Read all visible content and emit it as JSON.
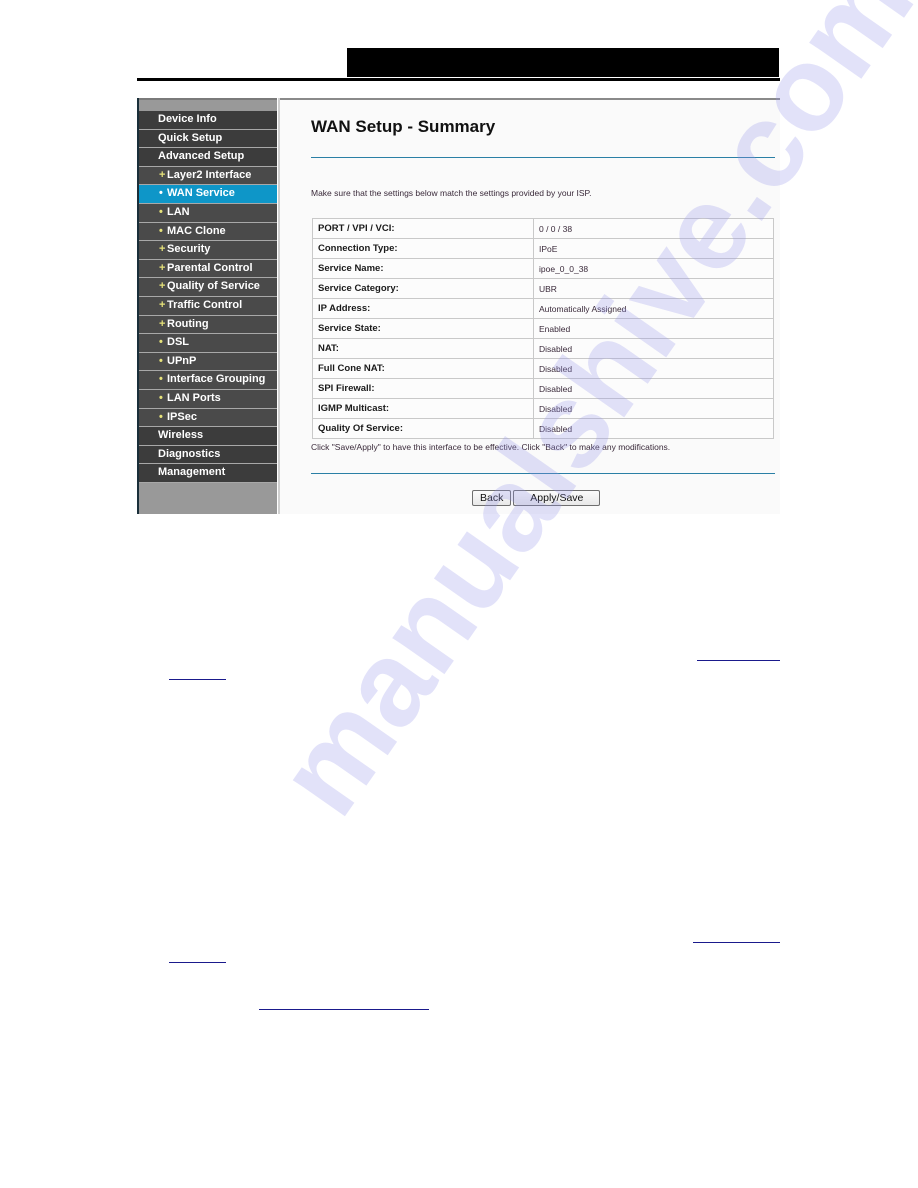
{
  "document": {
    "header_bar_text": "",
    "watermark": "manualshive.com"
  },
  "sidebar": {
    "items": [
      {
        "label": "Device Info",
        "level": "top",
        "marker": ""
      },
      {
        "label": "Quick Setup",
        "level": "top",
        "marker": ""
      },
      {
        "label": "Advanced Setup",
        "level": "top",
        "marker": ""
      },
      {
        "label": "Layer2 Interface",
        "level": "sub",
        "marker": "+"
      },
      {
        "label": "WAN Service",
        "level": "sub",
        "marker": "•",
        "active": true
      },
      {
        "label": "LAN",
        "level": "sub",
        "marker": "•"
      },
      {
        "label": "MAC Clone",
        "level": "sub",
        "marker": "•"
      },
      {
        "label": "Security",
        "level": "sub",
        "marker": "+"
      },
      {
        "label": "Parental Control",
        "level": "sub",
        "marker": "+"
      },
      {
        "label": "Quality of Service",
        "level": "sub",
        "marker": "+"
      },
      {
        "label": "Traffic Control",
        "level": "sub",
        "marker": "+"
      },
      {
        "label": "Routing",
        "level": "sub",
        "marker": "+"
      },
      {
        "label": "DSL",
        "level": "sub",
        "marker": "•"
      },
      {
        "label": "UPnP",
        "level": "sub",
        "marker": "•"
      },
      {
        "label": "Interface Grouping",
        "level": "sub",
        "marker": "•"
      },
      {
        "label": "LAN Ports",
        "level": "sub",
        "marker": "•"
      },
      {
        "label": "IPSec",
        "level": "sub",
        "marker": "•"
      },
      {
        "label": "Wireless",
        "level": "top",
        "marker": ""
      },
      {
        "label": "Diagnostics",
        "level": "top",
        "marker": ""
      },
      {
        "label": "Management",
        "level": "top",
        "marker": ""
      }
    ]
  },
  "main": {
    "title": "WAN Setup - Summary",
    "intro": "Make sure that the settings below match the settings provided by your ISP.",
    "summary_rows": [
      {
        "key": "PORT / VPI / VCI:",
        "value": "0 / 0 / 38"
      },
      {
        "key": "Connection Type:",
        "value": "IPoE"
      },
      {
        "key": "Service Name:",
        "value": "ipoe_0_0_38"
      },
      {
        "key": "Service Category:",
        "value": "UBR"
      },
      {
        "key": "IP Address:",
        "value": "Automatically Assigned"
      },
      {
        "key": "Service State:",
        "value": "Enabled"
      },
      {
        "key": "NAT:",
        "value": "Disabled"
      },
      {
        "key": "Full Cone NAT:",
        "value": "Disabled"
      },
      {
        "key": "SPI Firewall:",
        "value": "Disabled"
      },
      {
        "key": "IGMP Multicast:",
        "value": "Disabled"
      },
      {
        "key": "Quality Of Service:",
        "value": "Disabled"
      }
    ],
    "note": "Click \"Save/Apply\" to have this interface to be effective. Click \"Back\" to make any modifications.",
    "buttons": {
      "back": "Back",
      "apply_save": "Apply/Save"
    }
  },
  "colors": {
    "active_nav": "#0e96c8",
    "nav_bg": "#3c3c3c",
    "rule": "#2a7fa5",
    "link": "#1a1a8c"
  }
}
